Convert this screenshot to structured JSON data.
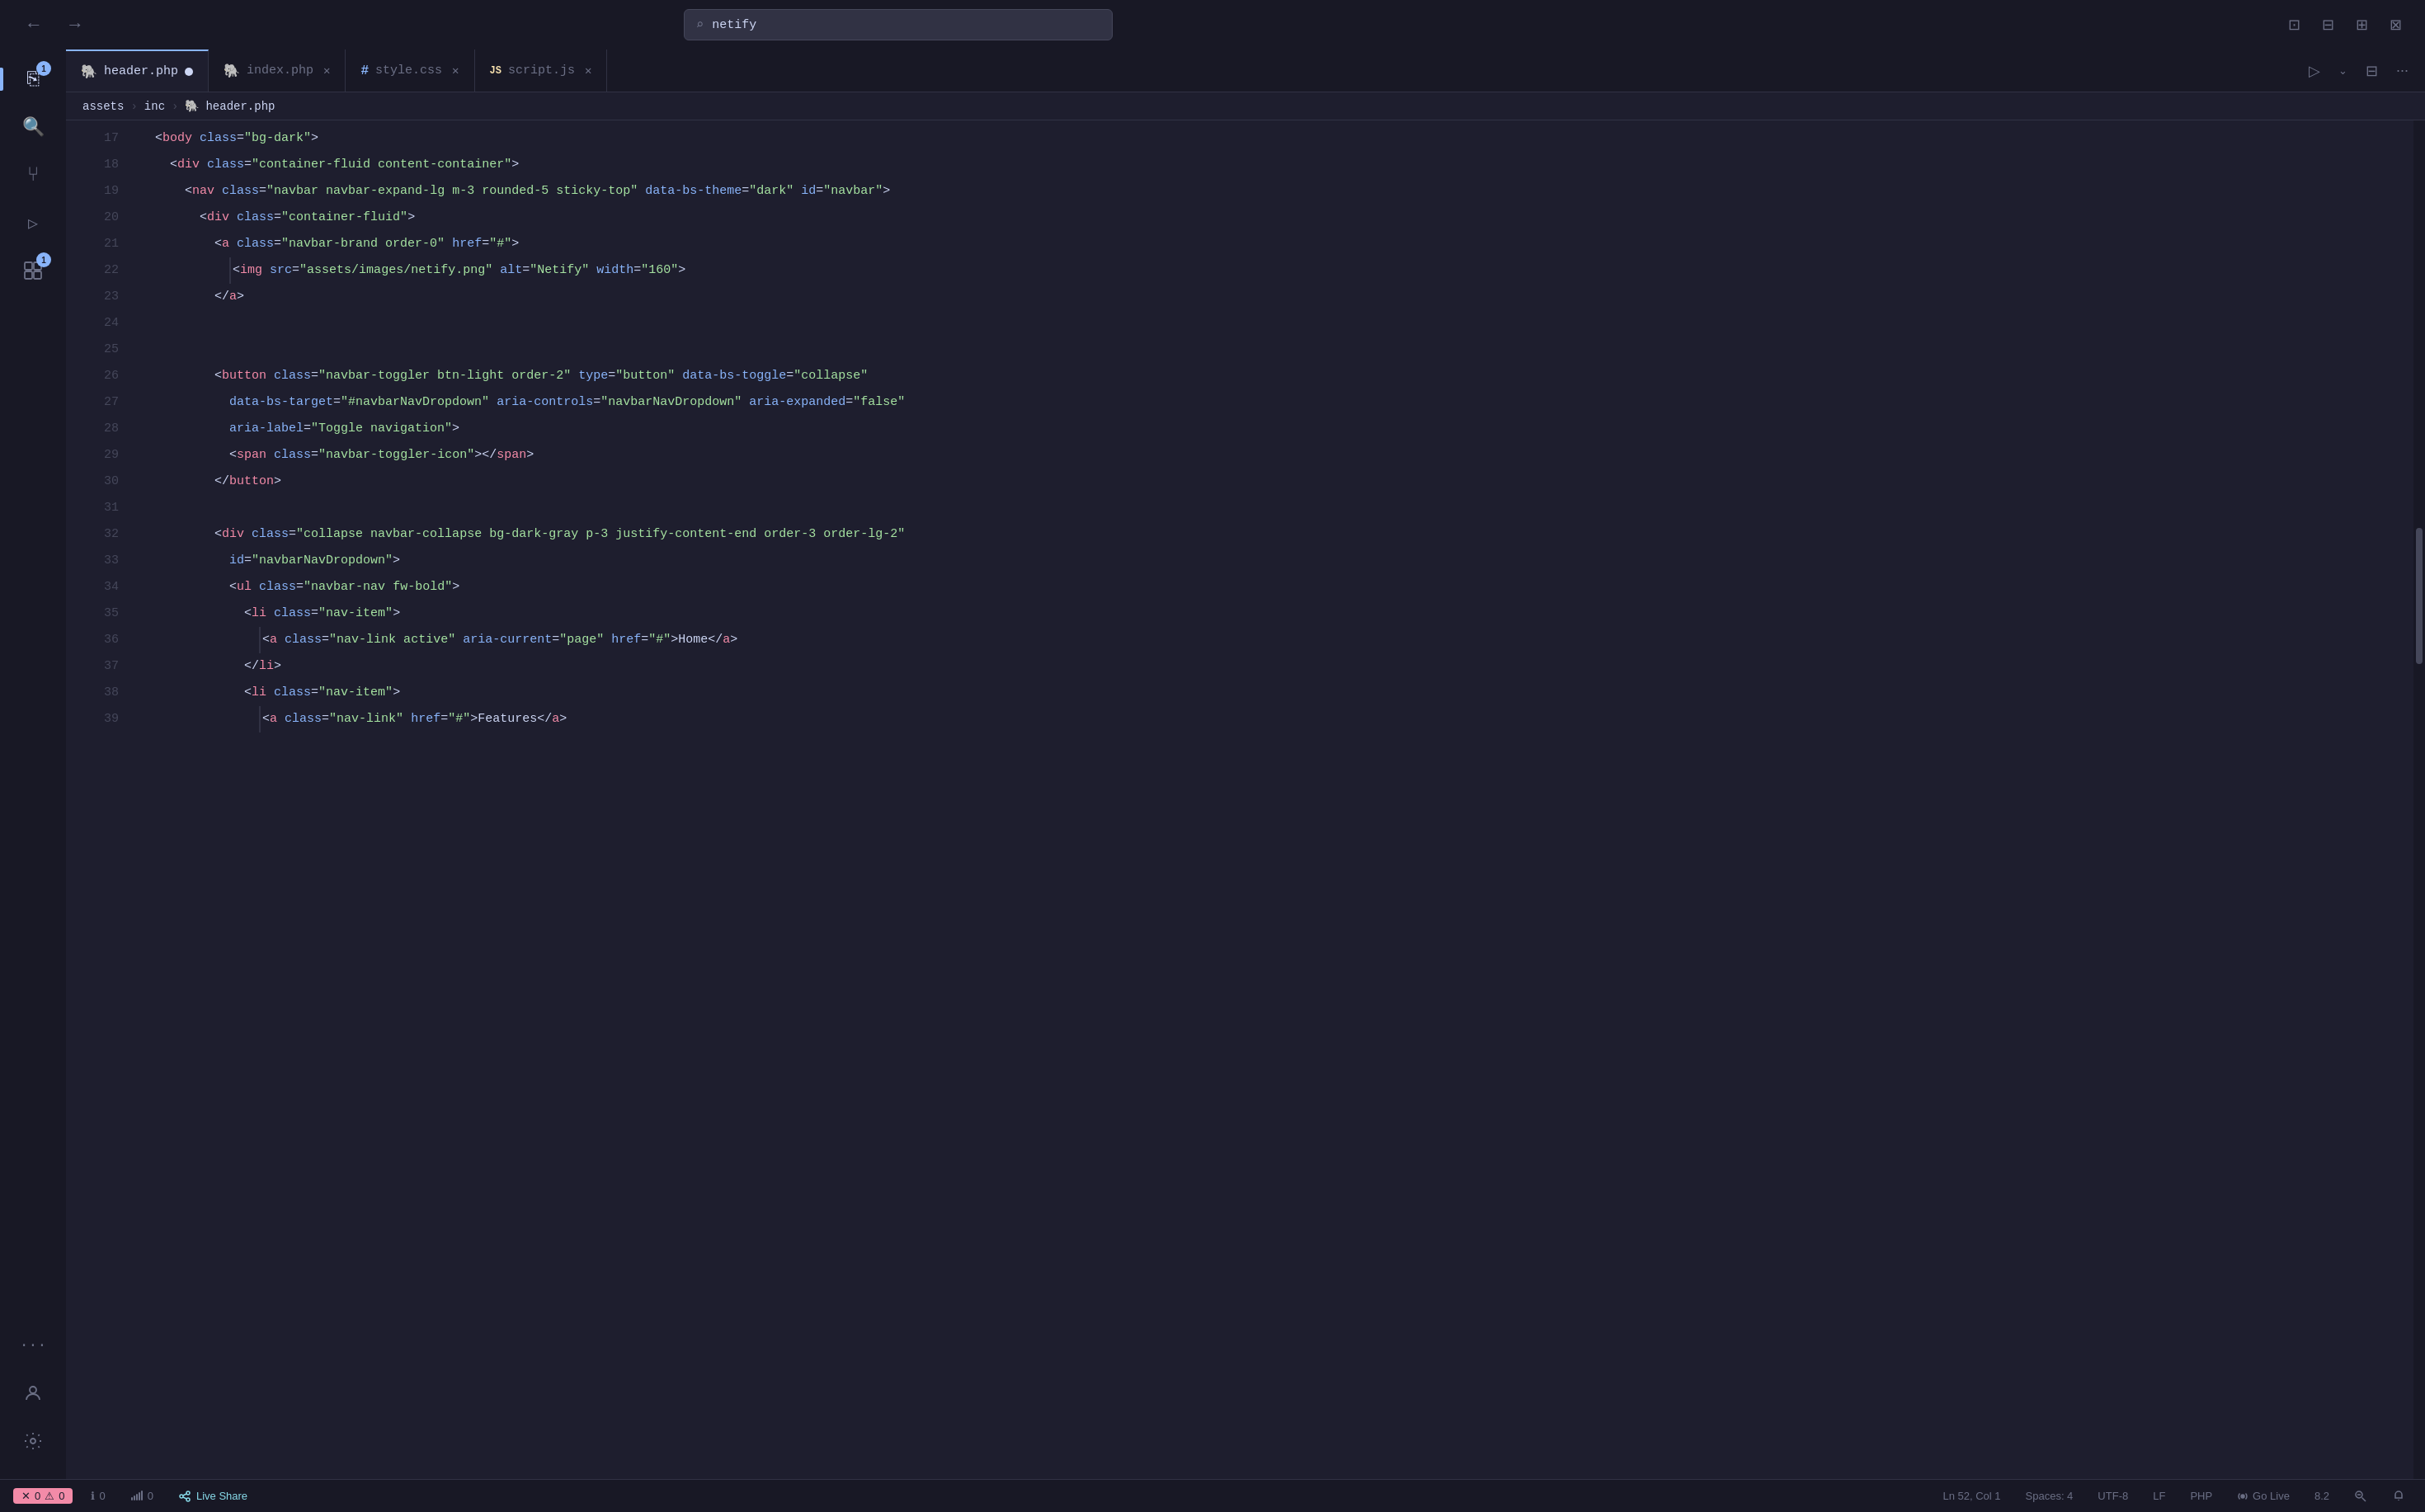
{
  "titlebar": {
    "search_placeholder": "netify",
    "nav_back": "←",
    "nav_forward": "→"
  },
  "tabs": [
    {
      "id": "header-php",
      "icon": "🐘",
      "icon_type": "php",
      "label": "header.php",
      "active": true,
      "modified": true
    },
    {
      "id": "index-php",
      "icon": "🐘",
      "icon_type": "php",
      "label": "index.php",
      "active": false,
      "modified": false
    },
    {
      "id": "style-css",
      "icon": "#",
      "icon_type": "css",
      "label": "style.css",
      "active": false,
      "modified": false
    },
    {
      "id": "script-js",
      "icon": "JS",
      "icon_type": "js",
      "label": "script.js",
      "active": false,
      "modified": false
    }
  ],
  "breadcrumb": {
    "parts": [
      "assets",
      "inc",
      "header.php"
    ]
  },
  "activity": {
    "items": [
      {
        "id": "explorer",
        "icon": "⎘",
        "badge": "1"
      },
      {
        "id": "search",
        "icon": "⌕"
      },
      {
        "id": "source-control",
        "icon": "⑂"
      },
      {
        "id": "run-debug",
        "icon": "▷"
      },
      {
        "id": "extensions",
        "icon": "⊞",
        "badge": "1"
      },
      {
        "id": "more",
        "icon": "···"
      }
    ],
    "bottom": [
      {
        "id": "account",
        "icon": "👤"
      },
      {
        "id": "settings",
        "icon": "⚙"
      }
    ]
  },
  "code_lines": [
    {
      "num": 17,
      "content": "  <body class=\"bg-dark\">",
      "tokens": [
        {
          "t": "ws",
          "v": "  "
        },
        {
          "t": "punct",
          "v": "<"
        },
        {
          "t": "tag",
          "v": "body"
        },
        {
          "t": "ws",
          "v": " "
        },
        {
          "t": "attr-name",
          "v": "class"
        },
        {
          "t": "eq",
          "v": "="
        },
        {
          "t": "attr-val",
          "v": "\"bg-dark\""
        },
        {
          "t": "punct",
          "v": ">"
        }
      ]
    },
    {
      "num": 18,
      "content": "    <div class=\"container-fluid content-container\">",
      "tokens": [
        {
          "t": "ws",
          "v": "    "
        },
        {
          "t": "punct",
          "v": "<"
        },
        {
          "t": "tag",
          "v": "div"
        },
        {
          "t": "ws",
          "v": " "
        },
        {
          "t": "attr-name",
          "v": "class"
        },
        {
          "t": "eq",
          "v": "="
        },
        {
          "t": "attr-val",
          "v": "\"container-fluid content-container\""
        },
        {
          "t": "punct",
          "v": ">"
        }
      ]
    },
    {
      "num": 19,
      "content": "      <nav class=\"navbar navbar-expand-lg m-3 rounded-5 sticky-top\" data-bs-theme=\"dark\" id=\"navbar\">",
      "tokens": [
        {
          "t": "ws",
          "v": "      "
        },
        {
          "t": "punct",
          "v": "<"
        },
        {
          "t": "tag",
          "v": "nav"
        },
        {
          "t": "ws",
          "v": " "
        },
        {
          "t": "attr-name",
          "v": "class"
        },
        {
          "t": "eq",
          "v": "="
        },
        {
          "t": "attr-val",
          "v": "\"navbar navbar-expand-lg m-3 rounded-5 sticky-top\""
        },
        {
          "t": "ws",
          "v": " "
        },
        {
          "t": "attr-name",
          "v": "data-bs-theme"
        },
        {
          "t": "eq",
          "v": "="
        },
        {
          "t": "attr-val",
          "v": "\"dark\""
        },
        {
          "t": "ws",
          "v": " "
        },
        {
          "t": "attr-name",
          "v": "id"
        },
        {
          "t": "eq",
          "v": "="
        },
        {
          "t": "attr-val",
          "v": "\"navbar\""
        },
        {
          "t": "punct",
          "v": ">"
        }
      ]
    },
    {
      "num": 20,
      "content": "        <div class=\"container-fluid\">",
      "tokens": [
        {
          "t": "ws",
          "v": "        "
        },
        {
          "t": "punct",
          "v": "<"
        },
        {
          "t": "tag",
          "v": "div"
        },
        {
          "t": "ws",
          "v": " "
        },
        {
          "t": "attr-name",
          "v": "class"
        },
        {
          "t": "eq",
          "v": "="
        },
        {
          "t": "attr-val",
          "v": "\"container-fluid\""
        },
        {
          "t": "punct",
          "v": ">"
        }
      ]
    },
    {
      "num": 21,
      "content": "          <a class=\"navbar-brand order-0\" href=\"#\">",
      "tokens": [
        {
          "t": "ws",
          "v": "          "
        },
        {
          "t": "punct",
          "v": "<"
        },
        {
          "t": "tag",
          "v": "a"
        },
        {
          "t": "ws",
          "v": " "
        },
        {
          "t": "attr-name",
          "v": "class"
        },
        {
          "t": "eq",
          "v": "="
        },
        {
          "t": "attr-val",
          "v": "\"navbar-brand order-0\""
        },
        {
          "t": "ws",
          "v": " "
        },
        {
          "t": "attr-name",
          "v": "href"
        },
        {
          "t": "eq",
          "v": "="
        },
        {
          "t": "attr-val",
          "v": "\"#\""
        },
        {
          "t": "punct",
          "v": ">"
        }
      ]
    },
    {
      "num": 22,
      "content": "            <img src=\"assets/images/netify.png\" alt=\"Netify\" width=\"160\">",
      "tokens": [
        {
          "t": "ws",
          "v": "            "
        },
        {
          "t": "punct",
          "v": "<"
        },
        {
          "t": "tag",
          "v": "img"
        },
        {
          "t": "ws",
          "v": " "
        },
        {
          "t": "attr-name",
          "v": "src"
        },
        {
          "t": "eq",
          "v": "="
        },
        {
          "t": "attr-val",
          "v": "\"assets/images/netify.png\""
        },
        {
          "t": "ws",
          "v": " "
        },
        {
          "t": "attr-name",
          "v": "alt"
        },
        {
          "t": "eq",
          "v": "="
        },
        {
          "t": "attr-val",
          "v": "\"Netify\""
        },
        {
          "t": "ws",
          "v": " "
        },
        {
          "t": "attr-name",
          "v": "width"
        },
        {
          "t": "eq",
          "v": "="
        },
        {
          "t": "attr-val",
          "v": "\"160\""
        },
        {
          "t": "punct",
          "v": ">"
        }
      ]
    },
    {
      "num": 23,
      "content": "          </a>",
      "tokens": [
        {
          "t": "ws",
          "v": "          "
        },
        {
          "t": "punct",
          "v": "</"
        },
        {
          "t": "tag",
          "v": "a"
        },
        {
          "t": "punct",
          "v": ">"
        }
      ]
    },
    {
      "num": 24,
      "content": "",
      "tokens": []
    },
    {
      "num": 25,
      "content": "",
      "tokens": []
    },
    {
      "num": 26,
      "content": "          <button class=\"navbar-toggler btn-light order-2\" type=\"button\" data-bs-toggle=\"collapse\"",
      "tokens": [
        {
          "t": "ws",
          "v": "          "
        },
        {
          "t": "punct",
          "v": "<"
        },
        {
          "t": "tag",
          "v": "button"
        },
        {
          "t": "ws",
          "v": " "
        },
        {
          "t": "attr-name",
          "v": "class"
        },
        {
          "t": "eq",
          "v": "="
        },
        {
          "t": "attr-val",
          "v": "\"navbar-toggler btn-light order-2\""
        },
        {
          "t": "ws",
          "v": " "
        },
        {
          "t": "attr-name",
          "v": "type"
        },
        {
          "t": "eq",
          "v": "="
        },
        {
          "t": "attr-val",
          "v": "\"button\""
        },
        {
          "t": "ws",
          "v": " "
        },
        {
          "t": "attr-name",
          "v": "data-bs-toggle"
        },
        {
          "t": "eq",
          "v": "="
        },
        {
          "t": "attr-val",
          "v": "\"collapse\""
        }
      ]
    },
    {
      "num": 27,
      "content": "            data-bs-target=\"#navbarNavDropdown\" aria-controls=\"navbarNavDropdown\" aria-expanded=\"false\"",
      "tokens": [
        {
          "t": "ws",
          "v": "            "
        },
        {
          "t": "attr-name",
          "v": "data-bs-target"
        },
        {
          "t": "eq",
          "v": "="
        },
        {
          "t": "attr-val",
          "v": "\"#navbarNavDropdown\""
        },
        {
          "t": "ws",
          "v": " "
        },
        {
          "t": "attr-name",
          "v": "aria-controls"
        },
        {
          "t": "eq",
          "v": "="
        },
        {
          "t": "attr-val",
          "v": "\"navbarNavDropdown\""
        },
        {
          "t": "ws",
          "v": " "
        },
        {
          "t": "attr-name",
          "v": "aria-expanded"
        },
        {
          "t": "eq",
          "v": "="
        },
        {
          "t": "attr-val",
          "v": "\"false\""
        }
      ]
    },
    {
      "num": 28,
      "content": "            aria-label=\"Toggle navigation\">",
      "tokens": [
        {
          "t": "ws",
          "v": "            "
        },
        {
          "t": "attr-name",
          "v": "aria-label"
        },
        {
          "t": "eq",
          "v": "="
        },
        {
          "t": "attr-val",
          "v": "\"Toggle navigation\""
        },
        {
          "t": "punct",
          "v": ">"
        }
      ]
    },
    {
      "num": 29,
      "content": "            <span class=\"navbar-toggler-icon\"></span>",
      "tokens": [
        {
          "t": "ws",
          "v": "            "
        },
        {
          "t": "punct",
          "v": "<"
        },
        {
          "t": "tag",
          "v": "span"
        },
        {
          "t": "ws",
          "v": " "
        },
        {
          "t": "attr-name",
          "v": "class"
        },
        {
          "t": "eq",
          "v": "="
        },
        {
          "t": "attr-val",
          "v": "\"navbar-toggler-icon\""
        },
        {
          "t": "punct",
          "v": ">"
        },
        {
          "t": "punct",
          "v": "</"
        },
        {
          "t": "tag",
          "v": "span"
        },
        {
          "t": "punct",
          "v": ">"
        }
      ]
    },
    {
      "num": 30,
      "content": "          </button>",
      "tokens": [
        {
          "t": "ws",
          "v": "          "
        },
        {
          "t": "punct",
          "v": "</"
        },
        {
          "t": "tag",
          "v": "button"
        },
        {
          "t": "punct",
          "v": ">"
        }
      ]
    },
    {
      "num": 31,
      "content": "",
      "tokens": []
    },
    {
      "num": 32,
      "content": "          <div class=\"collapse navbar-collapse bg-dark-gray p-3 justify-content-end order-3 order-lg-2\"",
      "tokens": [
        {
          "t": "ws",
          "v": "          "
        },
        {
          "t": "punct",
          "v": "<"
        },
        {
          "t": "tag",
          "v": "div"
        },
        {
          "t": "ws",
          "v": " "
        },
        {
          "t": "attr-name",
          "v": "class"
        },
        {
          "t": "eq",
          "v": "="
        },
        {
          "t": "attr-val",
          "v": "\"collapse navbar-collapse bg-dark-gray p-3 justify-content-end order-3 order-lg-2\""
        }
      ]
    },
    {
      "num": 33,
      "content": "            id=\"navbarNavDropdown\">",
      "tokens": [
        {
          "t": "ws",
          "v": "            "
        },
        {
          "t": "attr-name",
          "v": "id"
        },
        {
          "t": "eq",
          "v": "="
        },
        {
          "t": "attr-val",
          "v": "\"navbarNavDropdown\""
        },
        {
          "t": "punct",
          "v": ">"
        }
      ]
    },
    {
      "num": 34,
      "content": "            <ul class=\"navbar-nav fw-bold\">",
      "tokens": [
        {
          "t": "ws",
          "v": "            "
        },
        {
          "t": "punct",
          "v": "<"
        },
        {
          "t": "tag",
          "v": "ul"
        },
        {
          "t": "ws",
          "v": " "
        },
        {
          "t": "attr-name",
          "v": "class"
        },
        {
          "t": "eq",
          "v": "="
        },
        {
          "t": "attr-val",
          "v": "\"navbar-nav fw-bold\""
        },
        {
          "t": "punct",
          "v": ">"
        }
      ]
    },
    {
      "num": 35,
      "content": "              <li class=\"nav-item\">",
      "tokens": [
        {
          "t": "ws",
          "v": "              "
        },
        {
          "t": "punct",
          "v": "<"
        },
        {
          "t": "tag",
          "v": "li"
        },
        {
          "t": "ws",
          "v": " "
        },
        {
          "t": "attr-name",
          "v": "class"
        },
        {
          "t": "eq",
          "v": "="
        },
        {
          "t": "attr-val",
          "v": "\"nav-item\""
        },
        {
          "t": "punct",
          "v": ">"
        }
      ]
    },
    {
      "num": 36,
      "content": "                <a class=\"nav-link active\" aria-current=\"page\" href=\"#\">Home</a>",
      "tokens": [
        {
          "t": "ws",
          "v": "                "
        },
        {
          "t": "punct",
          "v": "<"
        },
        {
          "t": "tag",
          "v": "a"
        },
        {
          "t": "ws",
          "v": " "
        },
        {
          "t": "attr-name",
          "v": "class"
        },
        {
          "t": "eq",
          "v": "="
        },
        {
          "t": "attr-val",
          "v": "\"nav-link active\""
        },
        {
          "t": "ws",
          "v": " "
        },
        {
          "t": "attr-name",
          "v": "aria-current"
        },
        {
          "t": "eq",
          "v": "="
        },
        {
          "t": "attr-val",
          "v": "\"page\""
        },
        {
          "t": "ws",
          "v": " "
        },
        {
          "t": "attr-name",
          "v": "href"
        },
        {
          "t": "eq",
          "v": "="
        },
        {
          "t": "attr-val",
          "v": "\"#\""
        },
        {
          "t": "punct",
          "v": ">"
        },
        {
          "t": "text",
          "v": "Home"
        },
        {
          "t": "punct",
          "v": "</"
        },
        {
          "t": "tag",
          "v": "a"
        },
        {
          "t": "punct",
          "v": ">"
        }
      ]
    },
    {
      "num": 37,
      "content": "              </li>",
      "tokens": [
        {
          "t": "ws",
          "v": "              "
        },
        {
          "t": "punct",
          "v": "</"
        },
        {
          "t": "tag",
          "v": "li"
        },
        {
          "t": "punct",
          "v": ">"
        }
      ]
    },
    {
      "num": 38,
      "content": "              <li class=\"nav-item\">",
      "tokens": [
        {
          "t": "ws",
          "v": "              "
        },
        {
          "t": "punct",
          "v": "<"
        },
        {
          "t": "tag",
          "v": "li"
        },
        {
          "t": "ws",
          "v": " "
        },
        {
          "t": "attr-name",
          "v": "class"
        },
        {
          "t": "eq",
          "v": "="
        },
        {
          "t": "attr-val",
          "v": "\"nav-item\""
        },
        {
          "t": "punct",
          "v": ">"
        }
      ]
    },
    {
      "num": 39,
      "content": "                <a class=\"nav-link\" href=\"#\">Features</a>",
      "tokens": [
        {
          "t": "ws",
          "v": "                "
        },
        {
          "t": "punct",
          "v": "<"
        },
        {
          "t": "tag",
          "v": "a"
        },
        {
          "t": "ws",
          "v": " "
        },
        {
          "t": "attr-name",
          "v": "class"
        },
        {
          "t": "eq",
          "v": "="
        },
        {
          "t": "attr-val",
          "v": "\"nav-link\""
        },
        {
          "t": "ws",
          "v": " "
        },
        {
          "t": "attr-name",
          "v": "href"
        },
        {
          "t": "eq",
          "v": "="
        },
        {
          "t": "attr-val",
          "v": "\"#\""
        },
        {
          "t": "punct",
          "v": ">"
        },
        {
          "t": "text",
          "v": "Features"
        },
        {
          "t": "punct",
          "v": "</"
        },
        {
          "t": "tag",
          "v": "a"
        },
        {
          "t": "punct",
          "v": ">"
        }
      ]
    }
  ],
  "status_bar": {
    "errors": "0",
    "warnings": "0",
    "info": "0",
    "live_share": "Live Share",
    "cursor": "Ln 52, Col 1",
    "spaces": "Spaces: 4",
    "encoding": "UTF-8",
    "line_ending": "LF",
    "language": "PHP",
    "go_live": "Go Live",
    "version": "8.2"
  }
}
